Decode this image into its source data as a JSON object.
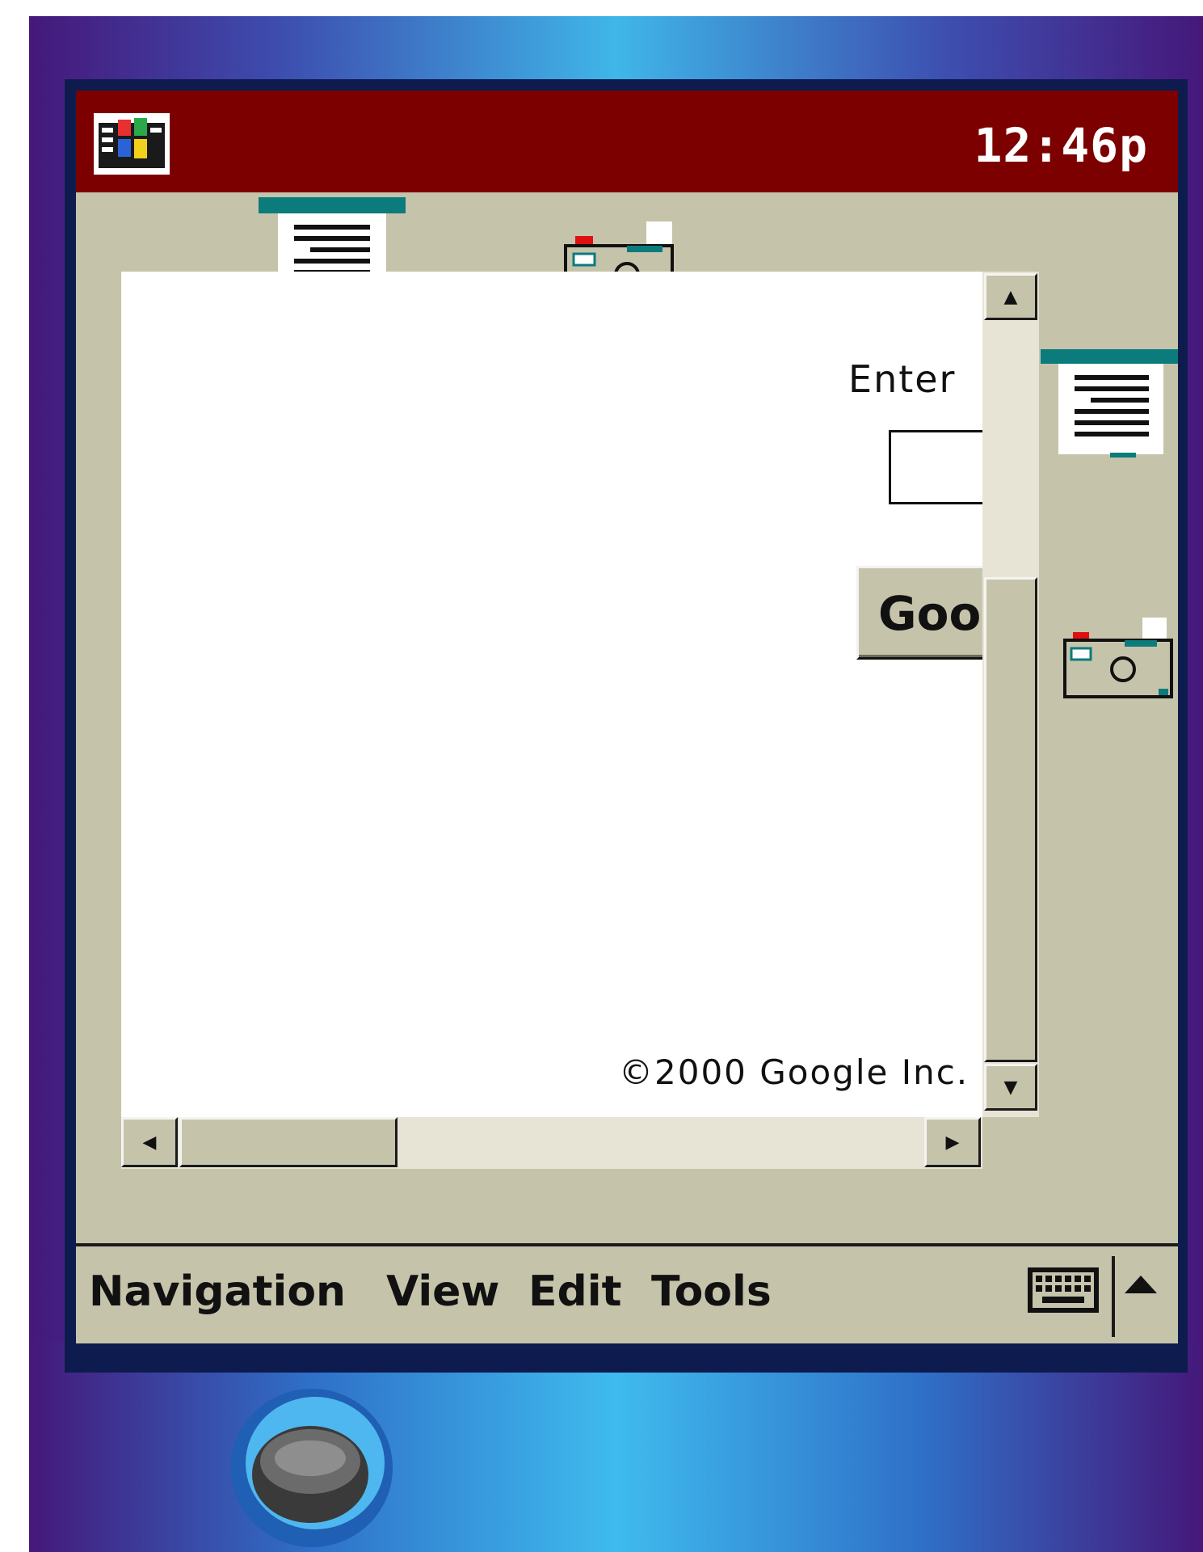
{
  "status_bar": {
    "start_icon": "windows-flag-icon",
    "clock": "12:46p"
  },
  "desktop_icons": [
    {
      "name": "document-icon"
    },
    {
      "name": "camera-icon"
    },
    {
      "name": "document-icon"
    },
    {
      "name": "camera-icon"
    }
  ],
  "page": {
    "enter_text": "Enter",
    "search_placeholder": "",
    "search_button_label": "Goo",
    "copyright": "©2000 Google Inc."
  },
  "menu": {
    "items": [
      "Navigation",
      "View",
      "Edit",
      "Tools"
    ],
    "keyboard_icon": "keyboard-icon",
    "sip_arrow_icon": "up-arrow-icon"
  },
  "colors": {
    "titlebar": "#7d0000",
    "chrome": "#c6c3ab",
    "content": "#ffffff"
  }
}
